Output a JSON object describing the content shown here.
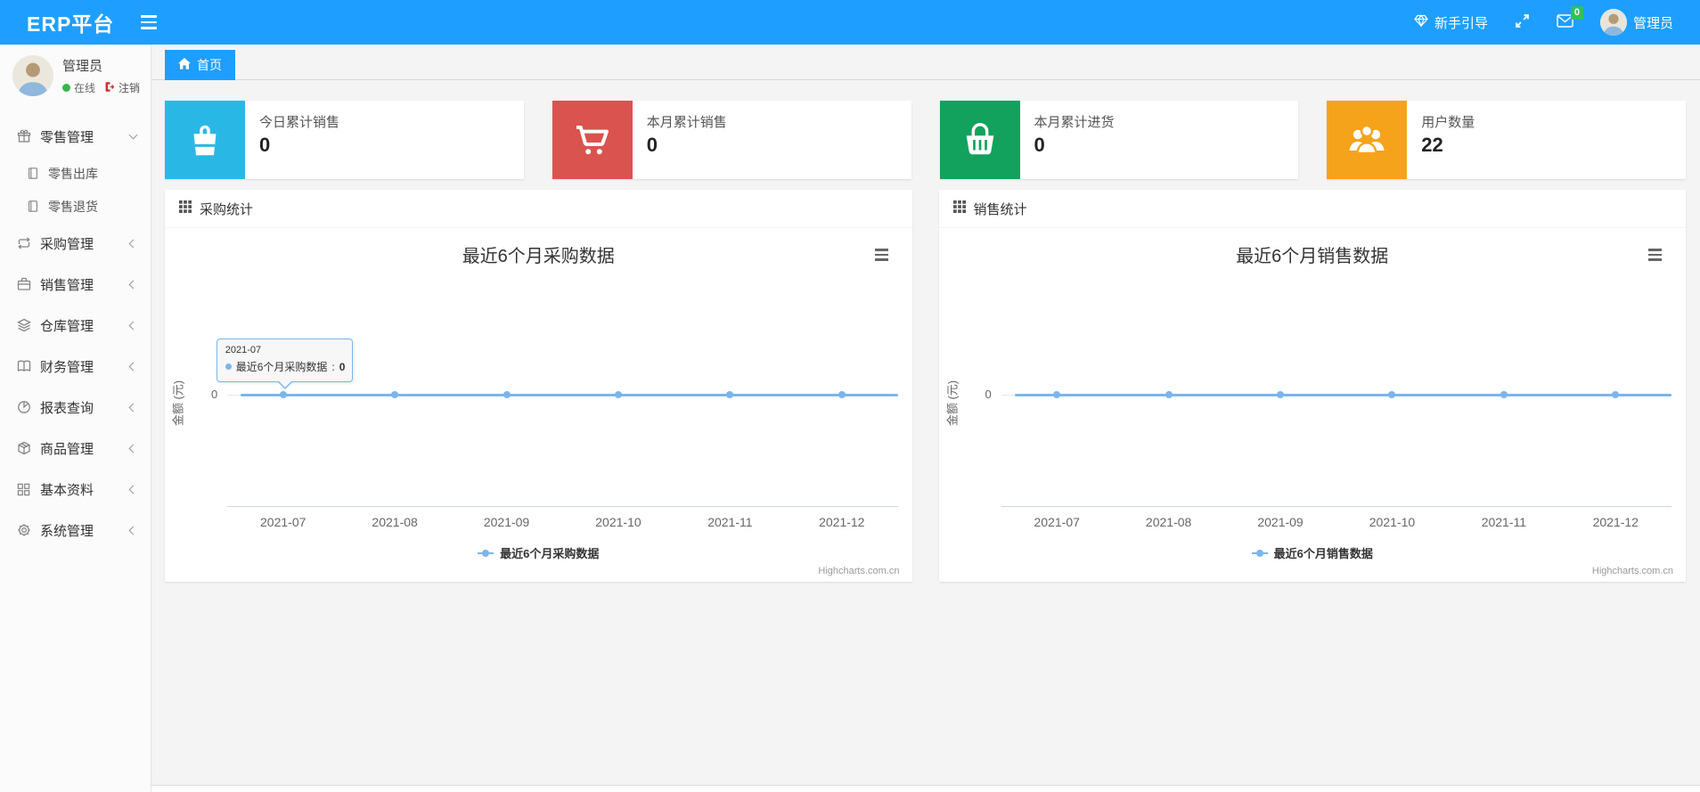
{
  "theme": {
    "primary": "#1e9fff",
    "badge_green": "#2fc25b",
    "online_green": "#39b54a",
    "logout_red": "#d9534f",
    "chart_line": "#7cb5ec"
  },
  "navbar": {
    "brand": "ERP平台",
    "guide_label": "新手引导",
    "message_badge": "0",
    "username": "管理员"
  },
  "sidebar": {
    "user": {
      "name": "管理员",
      "status": "在线",
      "logout": "注销"
    },
    "menu": [
      {
        "label": "零售管理",
        "icon": "gift-icon",
        "expanded": true,
        "children": [
          {
            "label": "零售出库",
            "icon": "journal-icon"
          },
          {
            "label": "零售退货",
            "icon": "journal-icon"
          }
        ]
      },
      {
        "label": "采购管理",
        "icon": "repeat-icon"
      },
      {
        "label": "销售管理",
        "icon": "briefcase-icon"
      },
      {
        "label": "仓库管理",
        "icon": "layers-icon"
      },
      {
        "label": "财务管理",
        "icon": "ledger-icon"
      },
      {
        "label": "报表查询",
        "icon": "pie-chart-icon"
      },
      {
        "label": "商品管理",
        "icon": "box-icon"
      },
      {
        "label": "基本资料",
        "icon": "grid-icon"
      },
      {
        "label": "系统管理",
        "icon": "gear-icon"
      }
    ]
  },
  "tabs": {
    "home": "首页"
  },
  "stat_cards": [
    {
      "title": "今日累计销售",
      "value": "0",
      "icon": "shopping-bag-icon",
      "color": "#29b8e5"
    },
    {
      "title": "本月累计销售",
      "value": "0",
      "icon": "shopping-cart-icon",
      "color": "#d9534f"
    },
    {
      "title": "本月累计进货",
      "value": "0",
      "icon": "shopping-basket-icon",
      "color": "#12a25d"
    },
    {
      "title": "用户数量",
      "value": "22",
      "icon": "users-icon",
      "color": "#f5a31a"
    }
  ],
  "panels": [
    {
      "header": "采购统计"
    },
    {
      "header": "销售统计"
    }
  ],
  "chart_data": [
    {
      "type": "line",
      "title": "最近6个月采购数据",
      "categories": [
        "2021-07",
        "2021-08",
        "2021-09",
        "2021-10",
        "2021-11",
        "2021-12"
      ],
      "series": [
        {
          "name": "最近6个月采购数据",
          "values": [
            0,
            0,
            0,
            0,
            0,
            0
          ]
        }
      ],
      "xlabel": "",
      "ylabel": "金额 (元)",
      "y_ticks": [
        "0"
      ],
      "ylim": [
        0,
        0
      ],
      "grid": true,
      "legend_position": "bottom",
      "line_color": "#7cb5ec",
      "credit": "Highcharts.com.cn",
      "tooltip": {
        "header": "2021-07",
        "series_name": "最近6个月采购数据",
        "separator": ": ",
        "value": "0"
      }
    },
    {
      "type": "line",
      "title": "最近6个月销售数据",
      "categories": [
        "2021-07",
        "2021-08",
        "2021-09",
        "2021-10",
        "2021-11",
        "2021-12"
      ],
      "series": [
        {
          "name": "最近6个月销售数据",
          "values": [
            0,
            0,
            0,
            0,
            0,
            0
          ]
        }
      ],
      "xlabel": "",
      "ylabel": "金额 (元)",
      "y_ticks": [
        "0"
      ],
      "ylim": [
        0,
        0
      ],
      "grid": true,
      "legend_position": "bottom",
      "line_color": "#7cb5ec",
      "credit": "Highcharts.com.cn"
    }
  ]
}
